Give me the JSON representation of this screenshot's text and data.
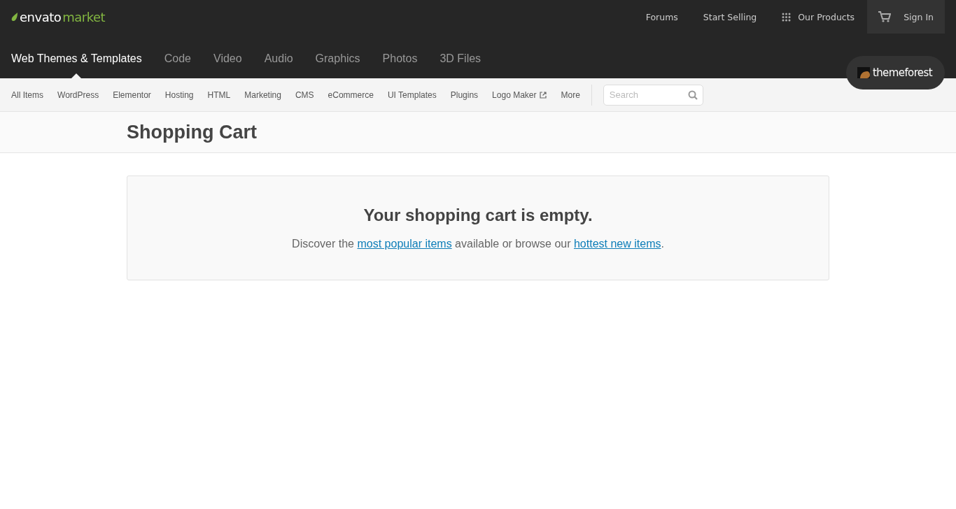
{
  "logo": {
    "brand": "envato",
    "product": "market"
  },
  "top_links": [
    {
      "label": "Forums",
      "kind": "plain"
    },
    {
      "label": "Start Selling",
      "kind": "plain"
    },
    {
      "label": "Our Products",
      "kind": "grid"
    },
    {
      "label": "Sign In",
      "kind": "cart"
    }
  ],
  "categories": [
    {
      "label": "Web Themes & Templates",
      "selected": true
    },
    {
      "label": "Code",
      "selected": false
    },
    {
      "label": "Video",
      "selected": false
    },
    {
      "label": "Audio",
      "selected": false
    },
    {
      "label": "Graphics",
      "selected": false
    },
    {
      "label": "Photos",
      "selected": false
    },
    {
      "label": "3D Files",
      "selected": false
    }
  ],
  "site_badge": {
    "label": "themeforest"
  },
  "subnav": [
    {
      "label": "All Items",
      "kind": "plain"
    },
    {
      "label": "WordPress",
      "kind": "plain"
    },
    {
      "label": "Elementor",
      "kind": "plain"
    },
    {
      "label": "Hosting",
      "kind": "plain"
    },
    {
      "label": "HTML",
      "kind": "plain"
    },
    {
      "label": "Marketing",
      "kind": "plain"
    },
    {
      "label": "CMS",
      "kind": "plain"
    },
    {
      "label": "eCommerce",
      "kind": "plain"
    },
    {
      "label": "UI Templates",
      "kind": "plain"
    },
    {
      "label": "Plugins",
      "kind": "plain"
    },
    {
      "label": "Logo Maker",
      "kind": "external"
    },
    {
      "label": "More",
      "kind": "plain"
    }
  ],
  "search": {
    "placeholder": "Search"
  },
  "page_title": "Shopping Cart",
  "empty_cart": {
    "heading": "Your shopping cart is empty.",
    "parts": [
      {
        "kind": "text",
        "text": "Discover the "
      },
      {
        "kind": "link",
        "text": "most popular items"
      },
      {
        "kind": "text",
        "text": " available or browse our "
      },
      {
        "kind": "link",
        "text": "hottest new items"
      },
      {
        "kind": "text",
        "text": "."
      }
    ]
  }
}
